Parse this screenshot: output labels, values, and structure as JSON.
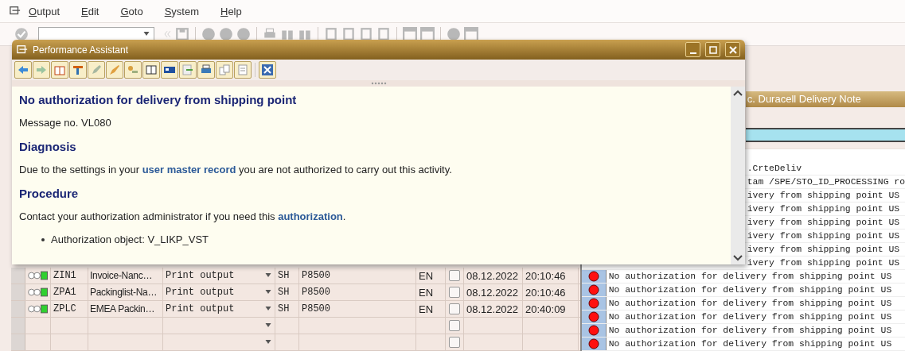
{
  "menu_bar": {
    "items": [
      {
        "label": "Output"
      },
      {
        "label": "Edit"
      },
      {
        "label": "Goto"
      },
      {
        "label": "System"
      },
      {
        "label": "Help"
      }
    ]
  },
  "output_table": {
    "rows": [
      {
        "kind": "filled",
        "processed": true,
        "column_1": "ZIN1",
        "column_2": "Invoice-Nanc…",
        "column_3": "Print output",
        "column_4": "SH",
        "column_5": "P8500",
        "column_6": "EN",
        "checked": false,
        "column_7": "08.12.2022",
        "column_8": "20:10:46"
      },
      {
        "kind": "filled",
        "processed": true,
        "column_1": "ZPA1",
        "column_2": "Packinglist-Na…",
        "column_3": "Print output",
        "column_4": "SH",
        "column_5": "P8500",
        "column_6": "EN",
        "checked": false,
        "column_7": "08.12.2022",
        "column_8": "20:10:46"
      },
      {
        "kind": "filled",
        "processed": true,
        "column_1": "ZPLC",
        "column_2": "EMEA Packin…",
        "column_3": "Print output",
        "column_4": "SH",
        "column_5": "P8500",
        "column_6": "EN",
        "checked": false,
        "column_7": "08.12.2022",
        "column_8": "20:40:09"
      },
      {
        "kind": "empty",
        "checked": false
      },
      {
        "kind": "empty",
        "checked": false
      }
    ]
  },
  "log_panel": {
    "title": "c. Duracell Delivery Note",
    "rows": [
      {
        "covered": true,
        "text": ".CrteDeliv"
      },
      {
        "covered": true,
        "text": "tam /SPE/STO_ID_PROCESSING ro"
      },
      {
        "covered": true,
        "text": "ivery from shipping point US"
      },
      {
        "covered": true,
        "text": "ivery from shipping point US"
      },
      {
        "covered": true,
        "text": "ivery from shipping point US"
      },
      {
        "covered": true,
        "text": "ivery from shipping point US"
      },
      {
        "covered": true,
        "text": "ivery from shipping point US"
      },
      {
        "covered": true,
        "text": "ivery from shipping point US"
      },
      {
        "covered": false,
        "error": true,
        "text": "No authorization for delivery from shipping point US"
      },
      {
        "covered": false,
        "error": true,
        "text": "No authorization for delivery from shipping point US"
      },
      {
        "covered": false,
        "error": true,
        "text": "No authorization for delivery from shipping point US"
      },
      {
        "covered": false,
        "error": true,
        "text": "No authorization for delivery from shipping point US"
      },
      {
        "covered": false,
        "error": true,
        "text": "No authorization for delivery from shipping point US"
      },
      {
        "covered": false,
        "error": true,
        "text": "No authorization for delivery from shipping point US"
      }
    ]
  },
  "popup": {
    "title": "Performance Assistant",
    "heading": "No authorization for delivery from shipping point",
    "message_no": "Message no. VL080",
    "sections": [
      {
        "title": "Diagnosis",
        "parts": [
          {
            "text": "Due to the settings in your "
          },
          {
            "text": "user master record",
            "link": true
          },
          {
            "text": " you are not authorized to carry out this activity."
          }
        ]
      },
      {
        "title": "Procedure",
        "parts": [
          {
            "text": "Contact your authorization administrator if you need this "
          },
          {
            "text": "authorization",
            "link": true
          },
          {
            "text": "."
          }
        ],
        "bullets": [
          "Authorization object: V_LIKP_VST"
        ]
      }
    ]
  }
}
